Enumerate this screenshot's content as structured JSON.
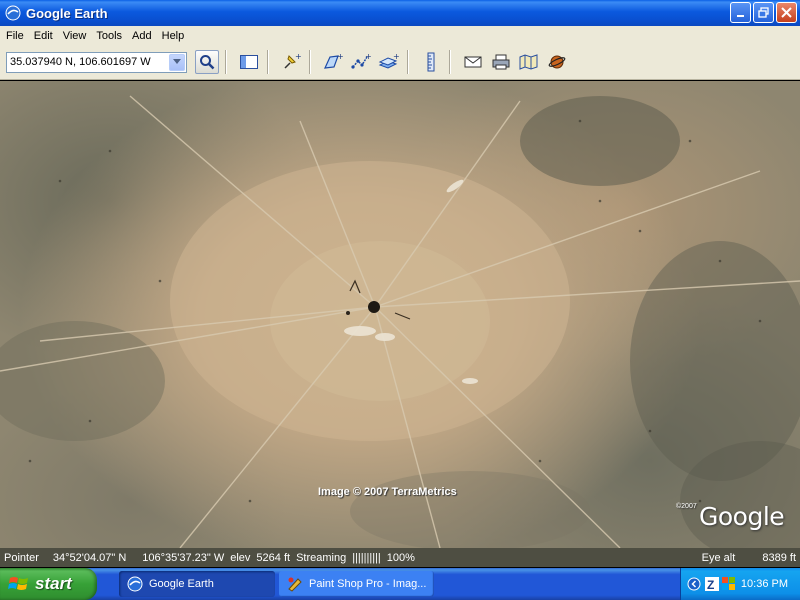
{
  "window": {
    "title": "Google Earth"
  },
  "menu": [
    "File",
    "Edit",
    "View",
    "Tools",
    "Add",
    "Help"
  ],
  "toolbar": {
    "search_value": "35.037940 N, 106.601697 W",
    "buttons": [
      {
        "name": "sidebar-toggle-button",
        "icon": "sidebar-icon"
      },
      {
        "name": "add-placemark-button",
        "icon": "pushpin-icon"
      },
      {
        "name": "add-polygon-button",
        "icon": "polygon-icon"
      },
      {
        "name": "add-path-button",
        "icon": "path-icon"
      },
      {
        "name": "add-image-overlay-button",
        "icon": "image-overlay-icon"
      },
      {
        "name": "ruler-button",
        "icon": "ruler-icon"
      },
      {
        "name": "email-button",
        "icon": "email-icon"
      },
      {
        "name": "print-button",
        "icon": "printer-icon"
      },
      {
        "name": "view-in-maps-button",
        "icon": "map-icon"
      },
      {
        "name": "sky-button",
        "icon": "planet-icon"
      }
    ]
  },
  "map": {
    "attribution": "Image © 2007 TerraMetrics",
    "logo_year": "©2007",
    "logo_text": "Google"
  },
  "status": {
    "pointer_label": "Pointer",
    "latitude": "34°52'04.07\" N",
    "longitude": "106°35'37.23\" W",
    "elev_label": "elev",
    "elev_value": "5264 ft",
    "streaming_label": "Streaming",
    "streaming_bar": "||||||||||",
    "streaming_percent": "100%",
    "eye_alt_label": "Eye alt",
    "eye_alt_value": "8389 ft"
  },
  "taskbar": {
    "start_label": "start",
    "tasks": [
      {
        "label": "Google Earth",
        "active": true
      },
      {
        "label": "Paint Shop Pro - Imag...",
        "active": false
      }
    ],
    "clock": "10:36 PM"
  }
}
